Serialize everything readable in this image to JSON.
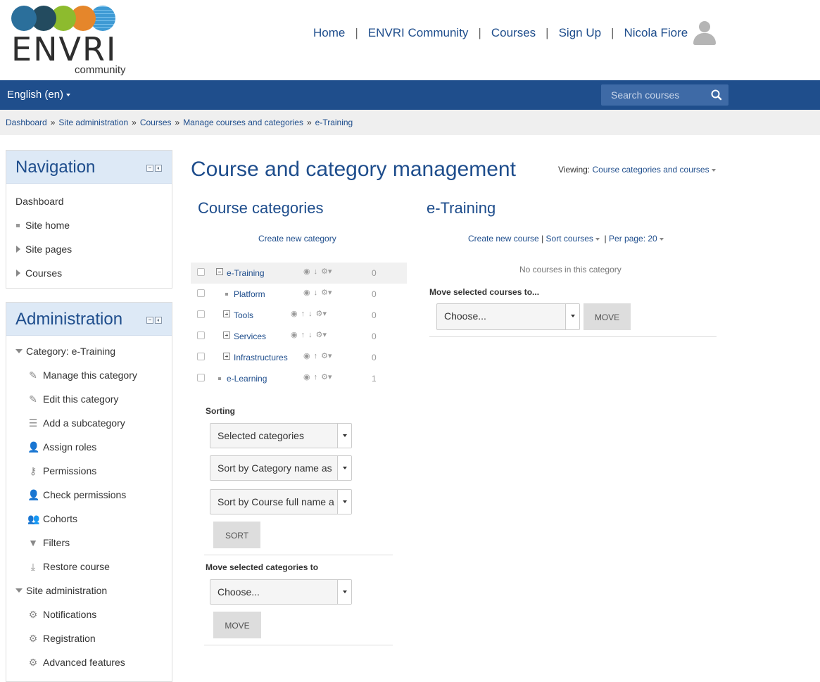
{
  "brand": {
    "wordmark": "ENVRI",
    "subtitle": "community",
    "circle_colors": [
      "#2b6f9b",
      "#234b5f",
      "#8dbb2e",
      "#e5862b",
      "#3e9ad4"
    ]
  },
  "topnav": {
    "items": [
      "Home",
      "ENVRI Community",
      "Courses",
      "Sign Up"
    ],
    "user_name": "Nicola Fiore"
  },
  "bar": {
    "language": "English (en)",
    "search_placeholder": "Search courses"
  },
  "breadcrumb": [
    "Dashboard",
    "Site administration",
    "Courses",
    "Manage courses and categories",
    "e-Training"
  ],
  "navigation_block": {
    "title": "Navigation",
    "items": [
      {
        "label": "Dashboard",
        "marker": "none"
      },
      {
        "label": "Site home",
        "marker": "bullet"
      },
      {
        "label": "Site pages",
        "marker": "collapsed"
      },
      {
        "label": "Courses",
        "marker": "collapsed"
      }
    ]
  },
  "administration_block": {
    "title": "Administration",
    "category_label": "Category: e-Training",
    "category_items": [
      {
        "label": "Manage this category",
        "icon": "pencil-icon"
      },
      {
        "label": "Edit this category",
        "icon": "pencil-icon"
      },
      {
        "label": "Add a subcategory",
        "icon": "subcategory-icon"
      },
      {
        "label": "Assign roles",
        "icon": "user-icon"
      },
      {
        "label": "Permissions",
        "icon": "key-icon"
      },
      {
        "label": "Check permissions",
        "icon": "user-icon"
      },
      {
        "label": "Cohorts",
        "icon": "cohort-icon"
      },
      {
        "label": "Filters",
        "icon": "filter-icon"
      },
      {
        "label": "Restore course",
        "icon": "restore-icon"
      }
    ],
    "site_admin_label": "Site administration",
    "site_admin_items": [
      {
        "label": "Notifications",
        "icon": "gear-icon"
      },
      {
        "label": "Registration",
        "icon": "gear-icon"
      },
      {
        "label": "Advanced features",
        "icon": "gear-icon"
      }
    ]
  },
  "main": {
    "heading": "Course and category management",
    "viewing_label": "Viewing:",
    "viewing_value": "Course categories and courses",
    "categories_heading": "Course categories",
    "create_category": "Create new category",
    "categories": [
      {
        "name": "e-Training",
        "count": "0",
        "expander": "minus",
        "hidden": false,
        "selected": true
      },
      {
        "name": "Platform",
        "count": "0",
        "expander": "leaf",
        "hidden": false,
        "selected": false
      },
      {
        "name": "Tools",
        "count": "0",
        "expander": "plus",
        "hidden": false,
        "selected": false
      },
      {
        "name": "Services",
        "count": "0",
        "expander": "plus",
        "hidden": false,
        "selected": false
      },
      {
        "name": "Infrastructures",
        "count": "0",
        "expander": "plus",
        "hidden": false,
        "selected": false
      },
      {
        "name": "e-Learning",
        "count": "1",
        "expander": "leaf",
        "hidden": false,
        "selected": false
      }
    ],
    "sorting_label": "Sorting",
    "sort_selects": [
      "Selected categories",
      "Sort by Category name as",
      "Sort by Course full name a"
    ],
    "sort_button": "SORT",
    "move_categories_label": "Move selected categories to",
    "move_categories_select": "Choose...",
    "move_categories_button": "MOVE",
    "course_heading": "e-Training",
    "create_course": "Create new course",
    "sort_courses": "Sort courses",
    "per_page": "Per page: 20",
    "no_courses": "No courses in this category",
    "move_courses_label": "Move selected courses to...",
    "move_courses_select": "Choose...",
    "move_courses_button": "MOVE"
  }
}
